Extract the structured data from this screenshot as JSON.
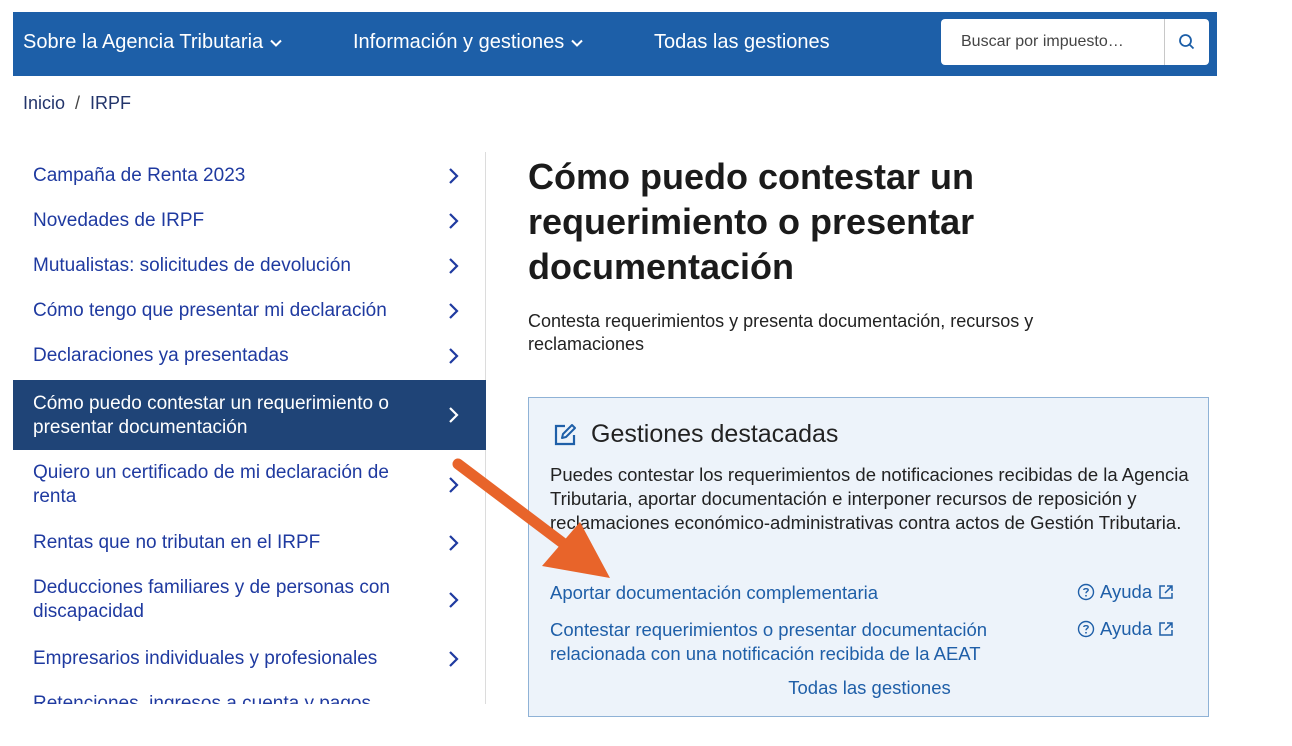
{
  "nav": {
    "about_label": "Sobre la Agencia Tributaria",
    "info_label": "Información y gestiones",
    "all_label": "Todas las gestiones",
    "search_placeholder": "Buscar por impuesto…"
  },
  "breadcrumb": {
    "home": "Inicio",
    "separator": "/",
    "current": "IRPF"
  },
  "sidebar": {
    "items": [
      {
        "label": "Campaña de Renta 2023"
      },
      {
        "label": "Novedades de IRPF"
      },
      {
        "label": "Mutualistas: solicitudes de devolución"
      },
      {
        "label": "Cómo tengo que presentar mi declaración"
      },
      {
        "label": "Declaraciones ya presentadas"
      },
      {
        "label": "Cómo puedo contestar un requerimiento o presentar documentación",
        "active": true
      },
      {
        "label": "Quiero un certificado de mi declaración de renta"
      },
      {
        "label": "Rentas que no tributan en el IRPF"
      },
      {
        "label": "Deducciones familiares y de personas con discapacidad"
      },
      {
        "label": "Empresarios individuales y profesionales"
      },
      {
        "label": "Retenciones, ingresos a cuenta y pagos"
      }
    ]
  },
  "main": {
    "title": "Cómo puedo contestar un requerimiento o presentar documentación",
    "subtitle": "Contesta requerimientos y presenta documentación, recursos y reclamaciones",
    "featured": {
      "heading": "Gestiones destacadas",
      "description": "Puedes contestar los requerimientos de notificaciones recibidas de la Agencia Tributaria, aportar documentación e interponer recursos de reposición y reclamaciones económico-administrativas contra actos de Gestión Tributaria.",
      "links": [
        {
          "label": "Aportar documentación complementaria",
          "help": "Ayuda"
        },
        {
          "label": "Contestar requerimientos o presentar documentación relacionada con una notificación recibida de la AEAT",
          "help": "Ayuda"
        }
      ],
      "all_label": "Todas las gestiones"
    }
  },
  "colors": {
    "nav_bg": "#1d5fa8",
    "active_bg": "#1f4477",
    "link": "#1f3aa0",
    "box_bg": "#edf3fa",
    "annotation_arrow": "#e8642a"
  }
}
